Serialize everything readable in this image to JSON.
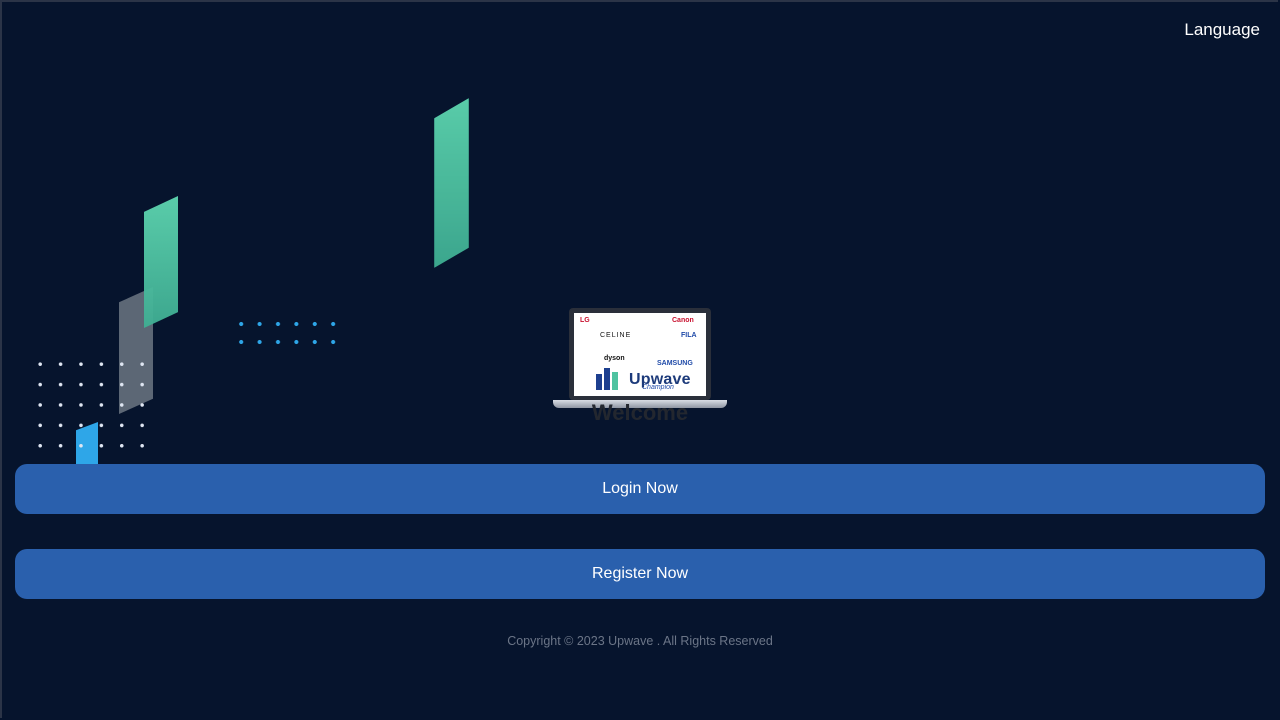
{
  "header": {
    "language_label": "Language"
  },
  "hero": {
    "logo_text": "Upwave",
    "welcome": "Welcome",
    "brand_logos": [
      "LG",
      "Canon",
      "CELINE",
      "FILA",
      "dyson",
      "SAMSUNG",
      "Champion"
    ]
  },
  "actions": {
    "login_label": "Login Now",
    "register_label": "Register Now"
  },
  "footer": {
    "copyright": "Copyright © 2023 Upwave . All Rights Reserved"
  },
  "colors": {
    "background": "#06142d",
    "button": "#2a60ad",
    "accent_green": "#4fc3a1",
    "accent_blue": "#2ea6e8"
  }
}
